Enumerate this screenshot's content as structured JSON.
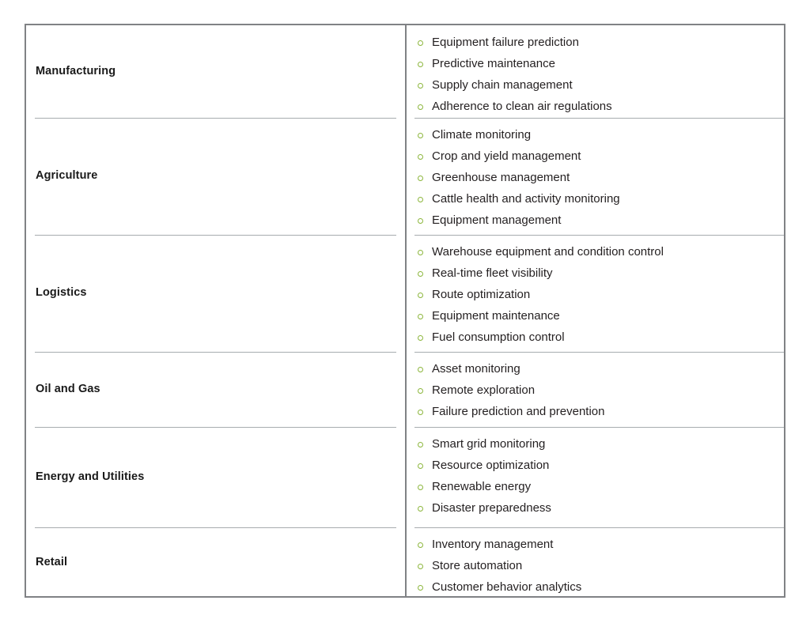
{
  "table": {
    "bullet_color": "#8cb63c",
    "border_color": "#808285",
    "separator_color": "#a7acaf",
    "text_color": "#231f20",
    "heading_color": "#1a1a1a",
    "rows": [
      {
        "category": "Manufacturing",
        "items": [
          "Equipment failure prediction",
          "Predictive maintenance",
          "Supply chain management",
          "Adherence to clean air regulations"
        ]
      },
      {
        "category": "Agriculture",
        "items": [
          "Climate monitoring",
          "Crop and yield management",
          "Greenhouse management",
          "Cattle health and activity monitoring",
          "Equipment management"
        ]
      },
      {
        "category": "Logistics",
        "items": [
          "Warehouse equipment and condition control",
          "Real-time fleet visibility",
          "Route optimization",
          "Equipment maintenance",
          "Fuel consumption control"
        ]
      },
      {
        "category": "Oil and Gas",
        "items": [
          "Asset monitoring",
          "Remote exploration",
          "Failure prediction and prevention"
        ]
      },
      {
        "category": "Energy and Utilities",
        "items": [
          "Smart grid monitoring",
          "Resource optimization",
          "Renewable energy",
          "Disaster preparedness"
        ]
      },
      {
        "category": "Retail",
        "items": [
          "Inventory management",
          "Store automation",
          "Customer behavior analytics"
        ]
      }
    ]
  }
}
